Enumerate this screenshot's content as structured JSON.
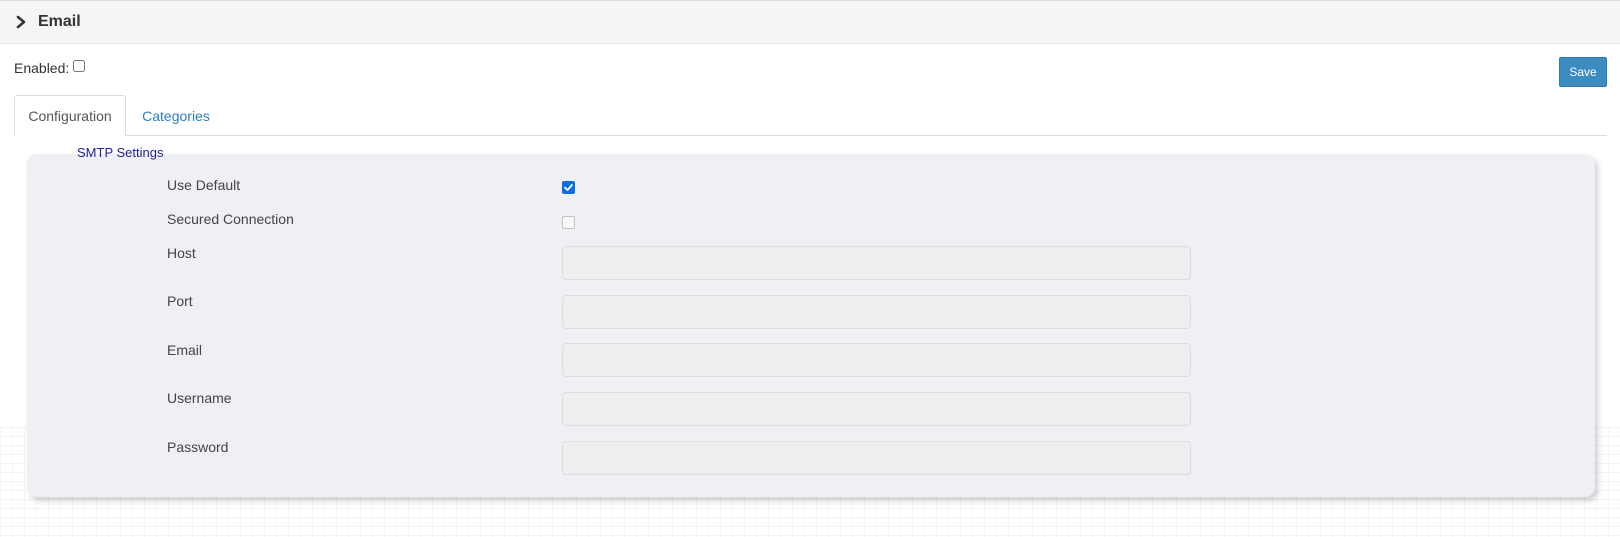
{
  "panel": {
    "title": "Email",
    "expand_icon": "chevron-right-icon"
  },
  "enabled": {
    "label": "Enabled:",
    "checked": false
  },
  "toolbar": {
    "save_label": "Save"
  },
  "tabs": [
    {
      "label": "Configuration",
      "active": true
    },
    {
      "label": "Categories",
      "active": false
    }
  ],
  "smtp": {
    "section_title": "SMTP Settings",
    "use_default": {
      "label": "Use Default",
      "checked": true
    },
    "secured_connection": {
      "label": "Secured Connection",
      "checked": false,
      "disabled": true
    },
    "host": {
      "label": "Host",
      "value": ""
    },
    "port": {
      "label": "Port",
      "value": ""
    },
    "email": {
      "label": "Email",
      "value": ""
    },
    "username": {
      "label": "Username",
      "value": ""
    },
    "password": {
      "label": "Password",
      "value": ""
    }
  },
  "colors": {
    "accent": "#3a8cc1",
    "link": "#2f7fb8",
    "section_title": "#1f1f8f",
    "checkbox_checked": "#0b6fe3"
  }
}
